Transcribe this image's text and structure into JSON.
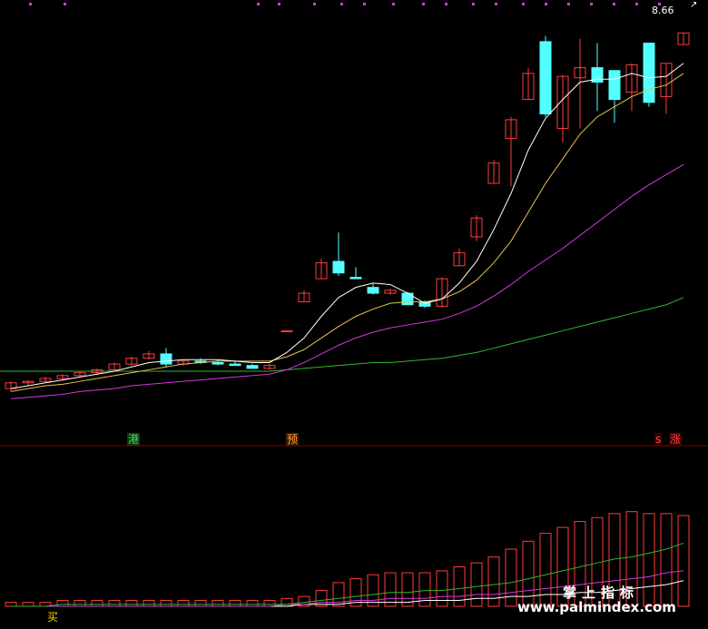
{
  "price_label": "8.66",
  "arrow_mark": "↗",
  "tags": {
    "gang": "港",
    "yu": "预",
    "s_mark": "s",
    "zhang": "涨",
    "buy": "买"
  },
  "watermark": {
    "cn": "掌上指标",
    "url": "www.palmindex.com"
  },
  "colors": {
    "up": "#ff3b3b",
    "down": "#54ffff",
    "ma_white": "#ffffff",
    "ma_yellow": "#e8c34a",
    "ma_magenta": "#d23adf",
    "ma_green": "#2fb52f"
  },
  "chart_data": [
    {
      "type": "candlestick",
      "title": "",
      "candles": [
        [
          6.2,
          6.25,
          6.18,
          6.24
        ],
        [
          6.24,
          6.26,
          6.22,
          6.25
        ],
        [
          6.25,
          6.28,
          6.24,
          6.27
        ],
        [
          6.27,
          6.3,
          6.26,
          6.29
        ],
        [
          6.29,
          6.32,
          6.28,
          6.31
        ],
        [
          6.31,
          6.34,
          6.3,
          6.33
        ],
        [
          6.33,
          6.38,
          6.32,
          6.37
        ],
        [
          6.37,
          6.42,
          6.36,
          6.41
        ],
        [
          6.41,
          6.46,
          6.4,
          6.44
        ],
        [
          6.44,
          6.48,
          6.35,
          6.37
        ],
        [
          6.37,
          6.4,
          6.36,
          6.39
        ],
        [
          6.39,
          6.41,
          6.37,
          6.38
        ],
        [
          6.38,
          6.4,
          6.36,
          6.37
        ],
        [
          6.37,
          6.39,
          6.36,
          6.36
        ],
        [
          6.36,
          6.37,
          6.34,
          6.34
        ],
        [
          6.34,
          6.37,
          6.33,
          6.36
        ],
        [
          6.6,
          6.6,
          6.6,
          6.6
        ],
        [
          6.8,
          6.88,
          6.8,
          6.86
        ],
        [
          6.96,
          7.1,
          6.96,
          7.07
        ],
        [
          7.08,
          7.28,
          6.98,
          7.0
        ],
        [
          6.97,
          7.04,
          6.96,
          6.96
        ],
        [
          6.9,
          6.93,
          6.85,
          6.86
        ],
        [
          6.86,
          6.89,
          6.85,
          6.88
        ],
        [
          6.86,
          6.87,
          6.78,
          6.78
        ],
        [
          6.8,
          6.81,
          6.76,
          6.77
        ],
        [
          6.77,
          6.97,
          6.76,
          6.96
        ],
        [
          7.05,
          7.17,
          7.05,
          7.14
        ],
        [
          7.25,
          7.4,
          7.22,
          7.38
        ],
        [
          7.62,
          7.78,
          7.62,
          7.76
        ],
        [
          7.93,
          8.08,
          7.6,
          8.06
        ],
        [
          8.2,
          8.42,
          8.2,
          8.38
        ],
        [
          8.6,
          8.64,
          8.08,
          8.1
        ],
        [
          8.0,
          8.37,
          7.9,
          8.36
        ],
        [
          8.35,
          8.62,
          8.0,
          8.42
        ],
        [
          8.42,
          8.59,
          8.12,
          8.32
        ],
        [
          8.4,
          8.38,
          8.04,
          8.2
        ],
        [
          8.25,
          8.45,
          8.12,
          8.44
        ],
        [
          8.59,
          8.59,
          8.15,
          8.18
        ],
        [
          8.22,
          8.45,
          8.1,
          8.45
        ],
        [
          8.58,
          8.66,
          8.58,
          8.66
        ]
      ],
      "ma_white": [
        6.2,
        6.22,
        6.24,
        6.26,
        6.28,
        6.3,
        6.32,
        6.35,
        6.38,
        6.39,
        6.4,
        6.4,
        6.4,
        6.39,
        6.38,
        6.38,
        6.45,
        6.55,
        6.7,
        6.83,
        6.9,
        6.93,
        6.92,
        6.86,
        6.79,
        6.82,
        6.93,
        7.08,
        7.3,
        7.55,
        7.85,
        8.07,
        8.2,
        8.32,
        8.34,
        8.34,
        8.38,
        8.35,
        8.36,
        8.45
      ],
      "ma_yellow": [
        6.18,
        6.2,
        6.22,
        6.23,
        6.25,
        6.27,
        6.29,
        6.31,
        6.33,
        6.35,
        6.37,
        6.38,
        6.39,
        6.39,
        6.39,
        6.39,
        6.42,
        6.47,
        6.55,
        6.63,
        6.7,
        6.75,
        6.79,
        6.8,
        6.8,
        6.82,
        6.87,
        6.95,
        7.07,
        7.22,
        7.42,
        7.62,
        7.79,
        7.96,
        8.08,
        8.15,
        8.22,
        8.27,
        8.3,
        8.38
      ],
      "ma_magenta": [
        6.13,
        6.14,
        6.15,
        6.16,
        6.18,
        6.19,
        6.2,
        6.22,
        6.23,
        6.24,
        6.25,
        6.26,
        6.27,
        6.28,
        6.29,
        6.3,
        6.33,
        6.38,
        6.44,
        6.5,
        6.55,
        6.59,
        6.62,
        6.64,
        6.66,
        6.68,
        6.72,
        6.77,
        6.84,
        6.92,
        7.01,
        7.09,
        7.17,
        7.26,
        7.35,
        7.44,
        7.53,
        7.61,
        7.68,
        7.75
      ],
      "ma_green": [
        6.32,
        6.32,
        6.32,
        6.32,
        6.32,
        6.32,
        6.32,
        6.32,
        6.32,
        6.32,
        6.32,
        6.32,
        6.32,
        6.32,
        6.32,
        6.32,
        6.33,
        6.34,
        6.35,
        6.36,
        6.37,
        6.38,
        6.38,
        6.39,
        6.4,
        6.41,
        6.43,
        6.45,
        6.48,
        6.51,
        6.54,
        6.57,
        6.6,
        6.63,
        6.66,
        6.69,
        6.72,
        6.75,
        6.78,
        6.83
      ],
      "ylim": [
        6.0,
        8.75
      ]
    },
    {
      "type": "bar",
      "title": "",
      "values": [
        2,
        2,
        2,
        3,
        3,
        3,
        3,
        3,
        3,
        3,
        3,
        3,
        3,
        3,
        3,
        3,
        4,
        5,
        8,
        12,
        14,
        16,
        17,
        17,
        17,
        18,
        20,
        22,
        25,
        29,
        33,
        37,
        40,
        43,
        45,
        47,
        48,
        47,
        47,
        46
      ],
      "line_green": [
        0,
        0,
        0,
        1,
        1,
        1,
        1,
        1,
        1,
        1,
        1,
        1,
        1,
        1,
        1,
        1,
        1,
        2,
        3,
        4,
        5,
        6,
        7,
        7,
        8,
        8,
        9,
        10,
        11,
        12,
        14,
        16,
        18,
        20,
        22,
        24,
        25,
        27,
        29,
        32
      ],
      "line_magenta": [
        0,
        0,
        0,
        0,
        0,
        0,
        0,
        0,
        0,
        0,
        0,
        0,
        0,
        0,
        0,
        0,
        1,
        1,
        2,
        2,
        3,
        3,
        4,
        4,
        4,
        5,
        5,
        6,
        6,
        7,
        8,
        9,
        10,
        11,
        12,
        13,
        14,
        15,
        17,
        18
      ],
      "line_white": [
        0,
        0,
        0,
        0,
        0,
        0,
        0,
        0,
        0,
        0,
        0,
        0,
        0,
        0,
        0,
        0,
        0,
        1,
        1,
        1,
        2,
        2,
        2,
        2,
        3,
        3,
        3,
        4,
        4,
        5,
        5,
        6,
        6,
        7,
        7,
        8,
        9,
        10,
        11,
        13
      ],
      "ylim": [
        0,
        52
      ]
    }
  ]
}
